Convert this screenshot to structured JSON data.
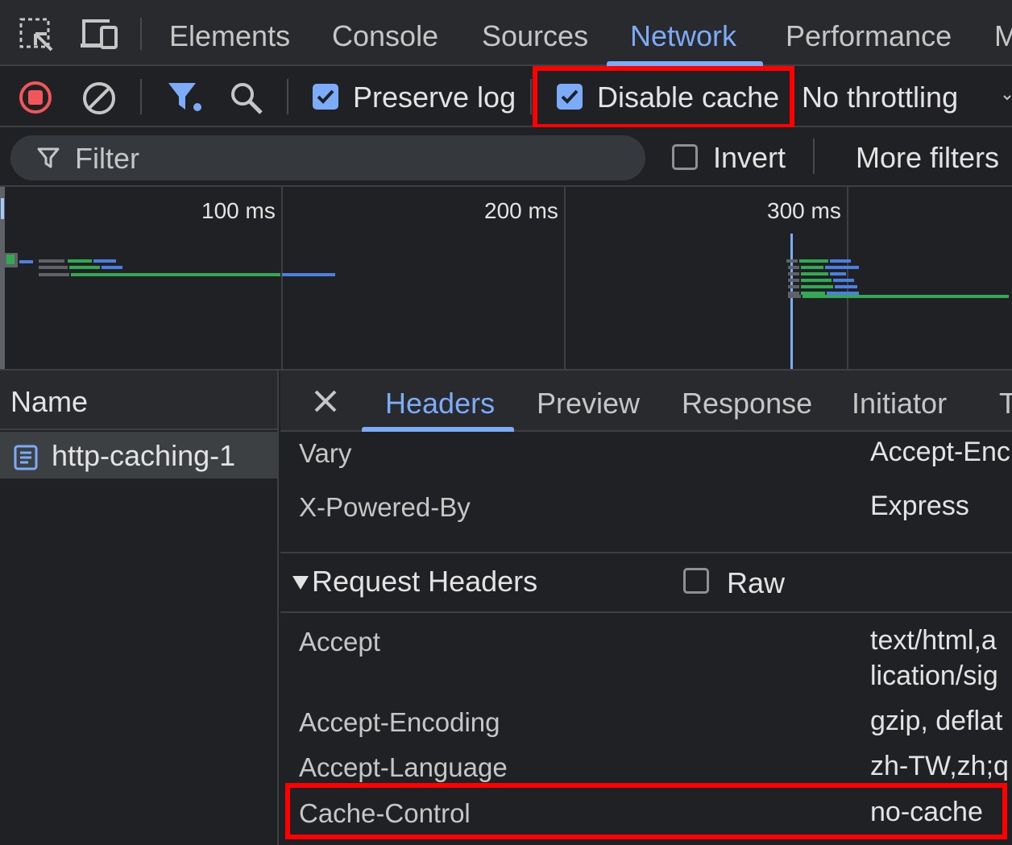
{
  "top_tabs": {
    "elements": "Elements",
    "console": "Console",
    "sources": "Sources",
    "network": "Network",
    "performance": "Performance",
    "more": "M"
  },
  "toolbar": {
    "preserve_log": "Preserve log",
    "disable_cache": "Disable cache",
    "throttling": "No throttling",
    "preserve_log_checked": true,
    "disable_cache_checked": true
  },
  "filter": {
    "placeholder": "Filter",
    "invert": "Invert",
    "more_filters": "More filters"
  },
  "timeline": {
    "ticks": [
      "100 ms",
      "200 ms",
      "300 ms"
    ]
  },
  "requests": {
    "column_header": "Name",
    "rows": [
      {
        "name": "http-caching-1"
      }
    ]
  },
  "detail": {
    "tabs": [
      "Headers",
      "Preview",
      "Response",
      "Initiator",
      "T"
    ],
    "response_headers": [
      {
        "name": "Vary",
        "value": "Accept-Enc"
      },
      {
        "name": "X-Powered-By",
        "value": "Express"
      }
    ],
    "request_section": {
      "title": "Request Headers",
      "raw_label": "Raw"
    },
    "request_headers": [
      {
        "name": "Accept",
        "value_line1": "text/html,a",
        "value_line2": "lication/sig"
      },
      {
        "name": "Accept-Encoding",
        "value": "gzip, deflat"
      },
      {
        "name": "Accept-Language",
        "value": "zh-TW,zh;q"
      },
      {
        "name": "Cache-Control",
        "value": "no-cache"
      }
    ]
  },
  "colors": {
    "accent": "#7cacf8",
    "highlight": "#ff0000",
    "record": "#f2555a",
    "waterfall_green": "#34a853",
    "waterfall_blue": "#4b7fe0"
  }
}
